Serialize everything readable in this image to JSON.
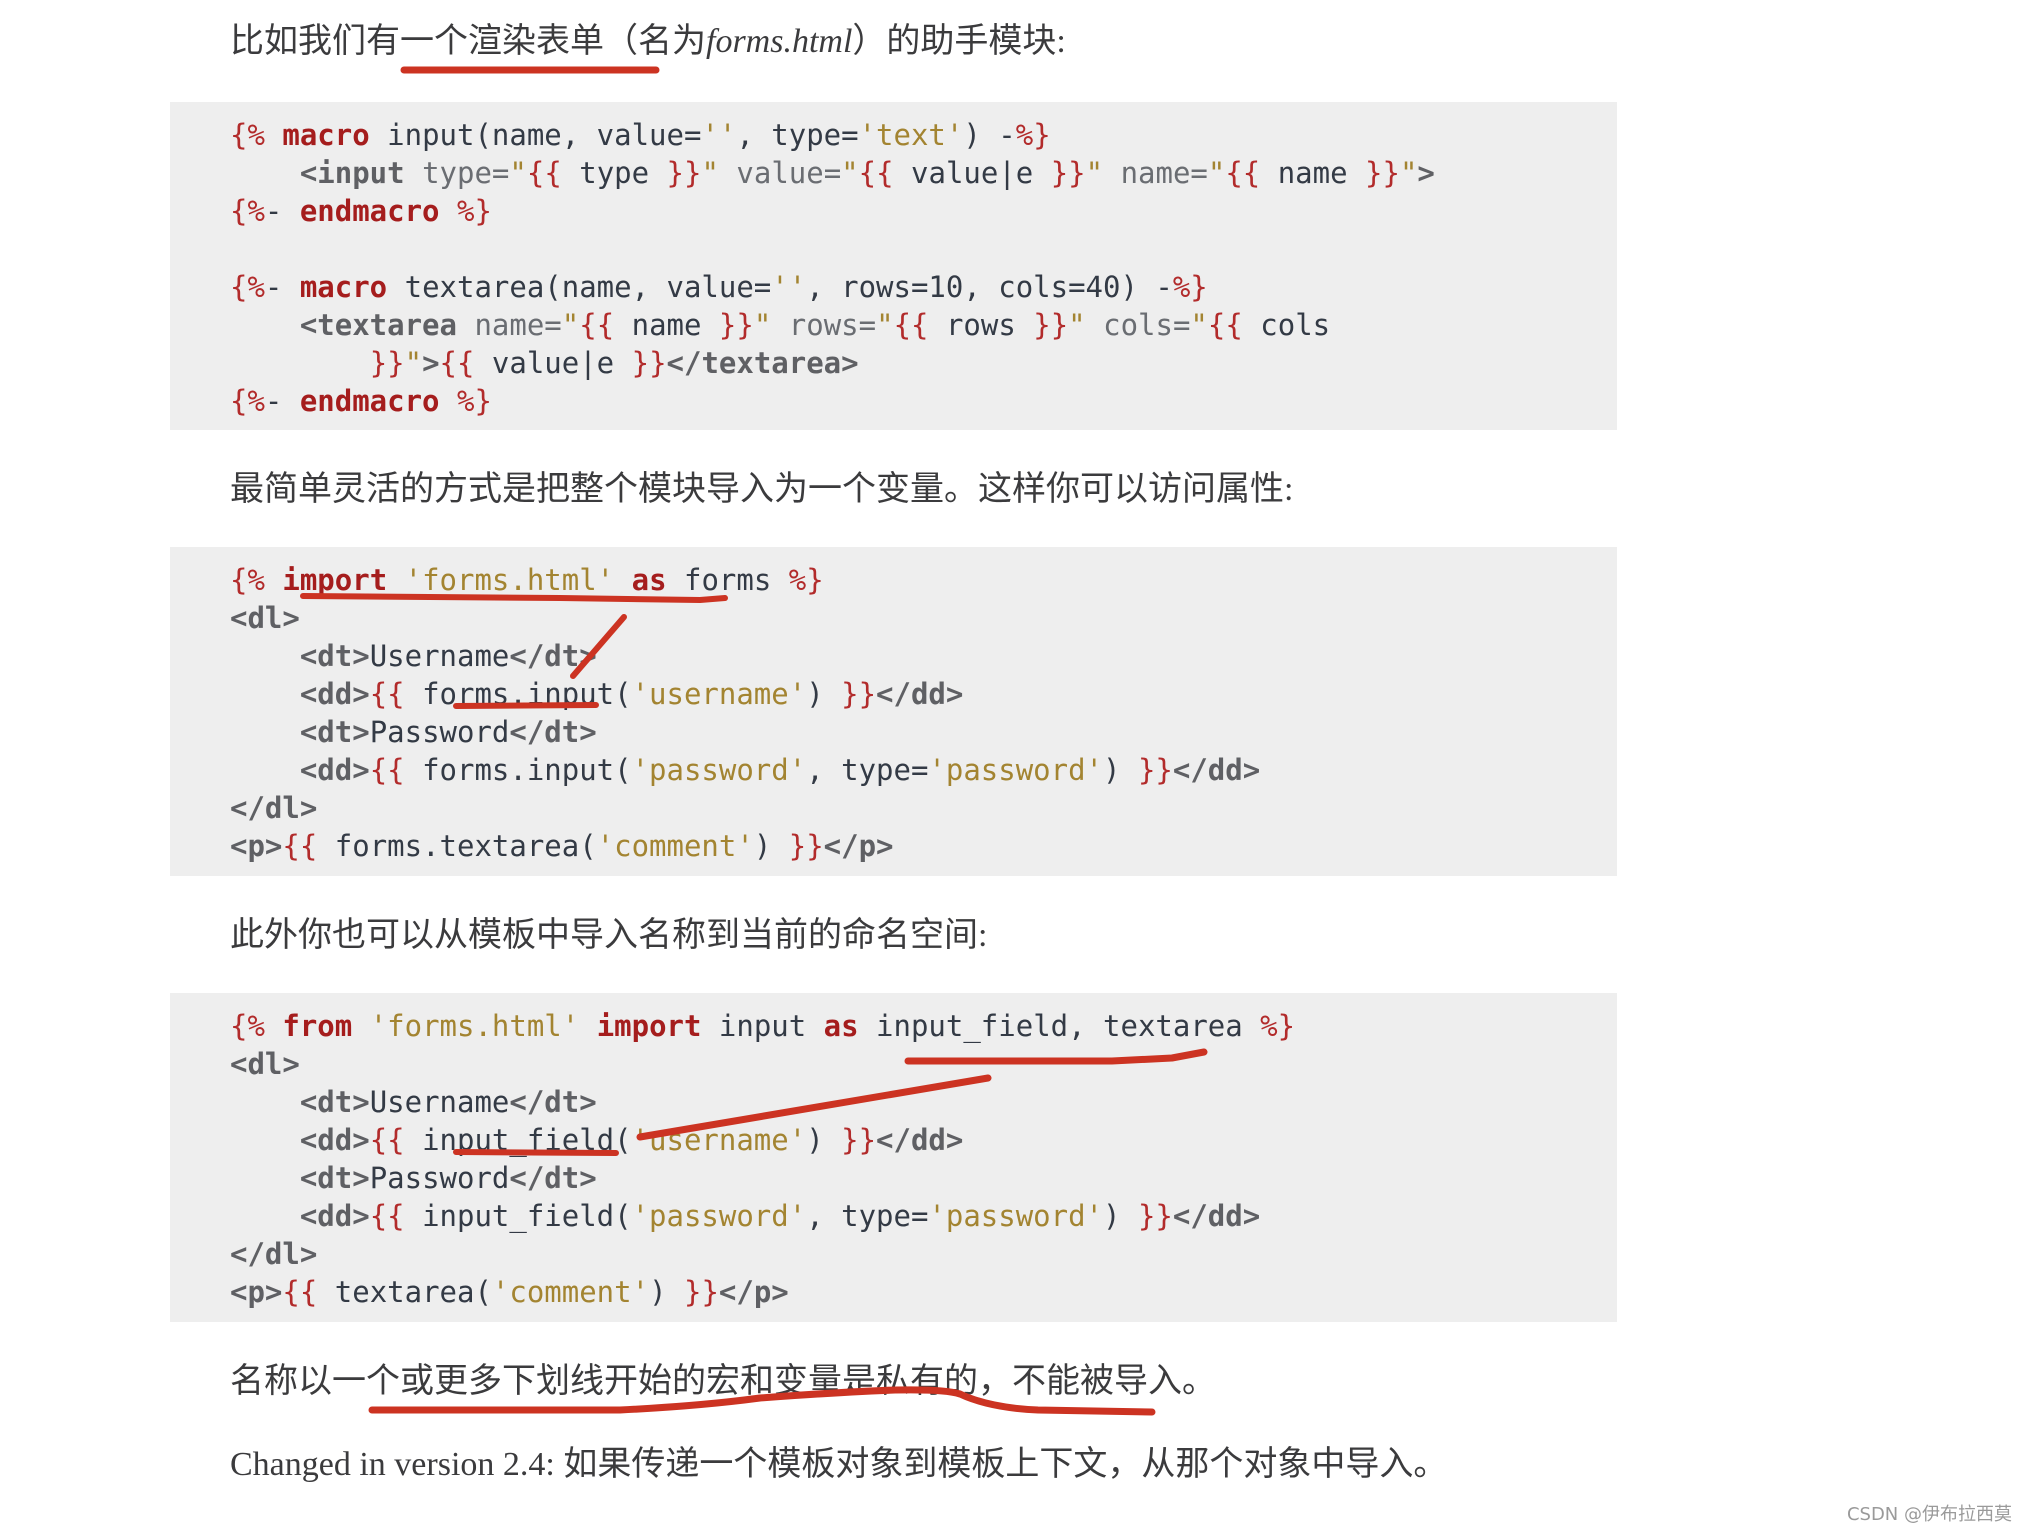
{
  "paragraphs": {
    "p1_before": "比如我们有一个渲染表单（名为",
    "p1_italic": "forms.html",
    "p1_after": "）的助手模块:",
    "p2": "最简单灵活的方式是把整个模块导入为一个变量。这样你可以访问属性:",
    "p3": "此外你也可以从模板中导入名称到当前的命名空间:",
    "p4": "名称以一个或更多下划线开始的宏和变量是私有的，不能被导入。",
    "p5": "Changed in version 2.4: 如果传递一个模板对象到模板上下文，从那个对象中导入。"
  },
  "code_blocks": [
    {
      "lines": [
        "{% macro input(name, value='', type='text') -%}",
        "    <input type=\"{{ type }}\" value=\"{{ value|e }}\" name=\"{{ name }}\">",
        "{%- endmacro %}",
        "",
        "{%- macro textarea(name, value='', rows=10, cols=40) -%}",
        "    <textarea name=\"{{ name }}\" rows=\"{{ rows }}\" cols=\"{{ cols",
        "        }}\">{{ value|e }}</textarea>",
        "{%- endmacro %}"
      ]
    },
    {
      "lines": [
        "{% import 'forms.html' as forms %}",
        "<dl>",
        "    <dt>Username</dt>",
        "    <dd>{{ forms.input('username') }}</dd>",
        "    <dt>Password</dt>",
        "    <dd>{{ forms.input('password', type='password') }}</dd>",
        "</dl>",
        "<p>{{ forms.textarea('comment') }}</p>"
      ]
    },
    {
      "lines": [
        "{% from 'forms.html' import input as input_field, textarea %}",
        "<dl>",
        "    <dt>Username</dt>",
        "    <dd>{{ input_field('username') }}</dd>",
        "    <dt>Password</dt>",
        "    <dd>{{ input_field('password', type='password') }}</dd>",
        "</dl>",
        "<p>{{ textarea('comment') }}</p>"
      ]
    }
  ],
  "colors": {
    "code_background": "#eeeeee",
    "keyword": "#a51d1d",
    "delimiter": "#b22b2b",
    "string": "#a38431",
    "tag": "#5f6064",
    "annotation": "#cc3322"
  },
  "watermark": "CSDN @伊布拉西莫"
}
